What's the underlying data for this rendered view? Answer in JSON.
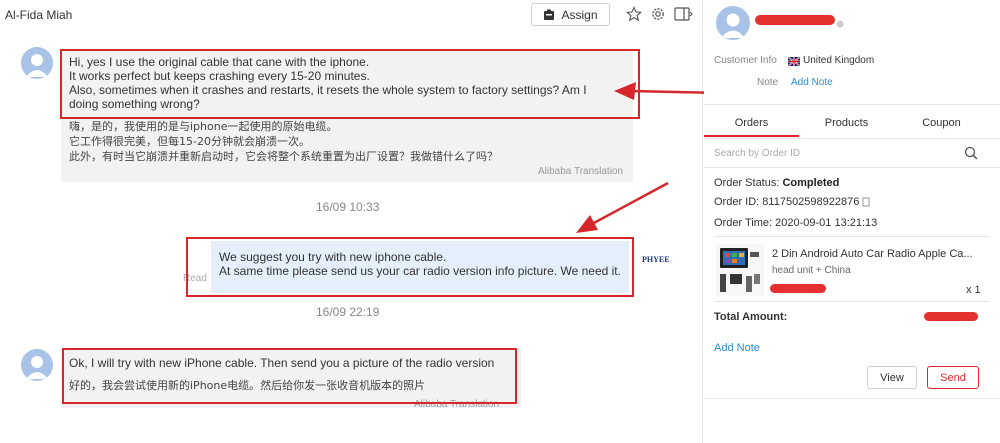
{
  "chat": {
    "contact_name": "Al-Fida Miah",
    "assign_label": "Assign",
    "messages": [
      {
        "text": "Hi, yes I use the original cable that cane with the iphone.\nIt works perfect but keeps crashing every 15-20 minutes.\nAlso, sometimes when it crashes and restarts, it resets the whole system to factory settings? Am I\ndoing something wrong?",
        "translation": "嗨，是的，我使用的是与iphone一起使用的原始电缆。\n它工作得很完美，但每15-20分钟就会崩溃一次。\n此外，有时当它崩溃并重新启动时，它会将整个系统重置为出厂设置？我做错什么了吗？",
        "translation_label": "Alibaba Translation"
      },
      {
        "timestamp": "16/09 10:33",
        "text": "We suggest you try with new iphone cable.\nAt same time please send us your car radio version info picture. We need it.",
        "read_label": "Read",
        "brand": "PHYEE"
      },
      {
        "timestamp": "16/09 22:19",
        "text": "Ok, I will try with new iPhone cable. Then send you a picture of the radio version",
        "translation": "好的，我会尝试使用新的iPhone电缆。然后给你发一张收音机版本的照片",
        "translation_label": "Alibaba Translation"
      }
    ]
  },
  "customer": {
    "info_label": "Customer Info",
    "country": "United Kingdom",
    "note_label": "Note",
    "add_note": "Add Note"
  },
  "tabs": [
    "Orders",
    "Products",
    "Coupon"
  ],
  "search": {
    "placeholder": "Search by Order ID"
  },
  "order": {
    "status_label": "Order Status:",
    "status_value": "Completed",
    "id_label": "Order ID:",
    "id_value": "8117502598922876",
    "time_label": "Order Time:",
    "time_value": "2020-09-01 13:21:13",
    "product_title": "2 Din Android Auto Car Radio Apple Ca...",
    "product_variant": "head unit + China",
    "quantity": "x 1",
    "total_label": "Total Amount:",
    "add_note": "Add Note",
    "view_label": "View",
    "send_label": "Send"
  },
  "colors": {
    "accent_red": "#d6282c",
    "link_blue": "#2a8bd6"
  }
}
